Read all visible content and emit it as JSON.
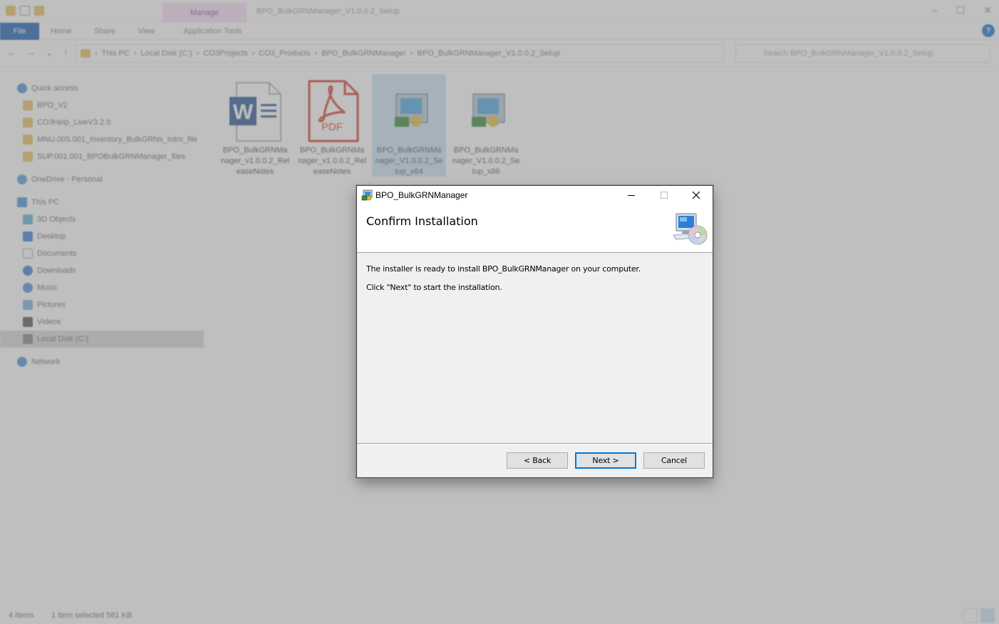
{
  "explorer": {
    "window_title": "BPO_BulkGRNManager_V1.0.0.2_Setup",
    "context_tab": "Manage",
    "ribbon_tabs": [
      "File",
      "Home",
      "Share",
      "View",
      "Application Tools"
    ],
    "breadcrumb": [
      "This PC",
      "Local Disk (C:)",
      "CO3Projects",
      "CO3_Products",
      "BPO_BulkGRNManager",
      "BPO_BulkGRNManager_V1.0.0.2_Setup"
    ],
    "search_placeholder": "Search BPO_BulkGRNManager_V1.0.0.2_Setup",
    "nav": {
      "quick_access": "Quick access",
      "quick_items": [
        "BPO_V2",
        "CO3Help_LiveV3.2.0",
        "MNU.005.001_Inventory_BulkGRNs_Intro_file",
        "SUP.001.001_BPOBulkGRNManager_files"
      ],
      "onedrive": "OneDrive - Personal",
      "this_pc": "This PC",
      "pc_items": [
        "3D Objects",
        "Desktop",
        "Documents",
        "Downloads",
        "Music",
        "Pictures",
        "Videos",
        "Local Disk (C:)"
      ],
      "network": "Network"
    },
    "files": [
      {
        "name": "BPO_BulkGRNManager_v1.0.0.2_ReleaseNotes",
        "icon": "word-icon"
      },
      {
        "name": "BPO_BulkGRNManager_v1.0.0.2_ReleaseNotes",
        "icon": "pdf-icon",
        "badge": "PDF"
      },
      {
        "name": "BPO_BulkGRNManager_V1.0.0.2_Setup_x64",
        "icon": "installer-icon"
      },
      {
        "name": "BPO_BulkGRNManager_V1.0.0.2_Setup_x86",
        "icon": "installer-icon"
      }
    ],
    "status": {
      "items": "4 items",
      "selected": "1 item selected  581 KB"
    }
  },
  "dialog": {
    "title": "BPO_BulkGRNManager",
    "heading": "Confirm Installation",
    "line1": "The installer is ready to install BPO_BulkGRNManager on your computer.",
    "line2": "Click \"Next\" to start the installation.",
    "buttons": {
      "back": "< Back",
      "next": "Next >",
      "cancel": "Cancel"
    }
  }
}
